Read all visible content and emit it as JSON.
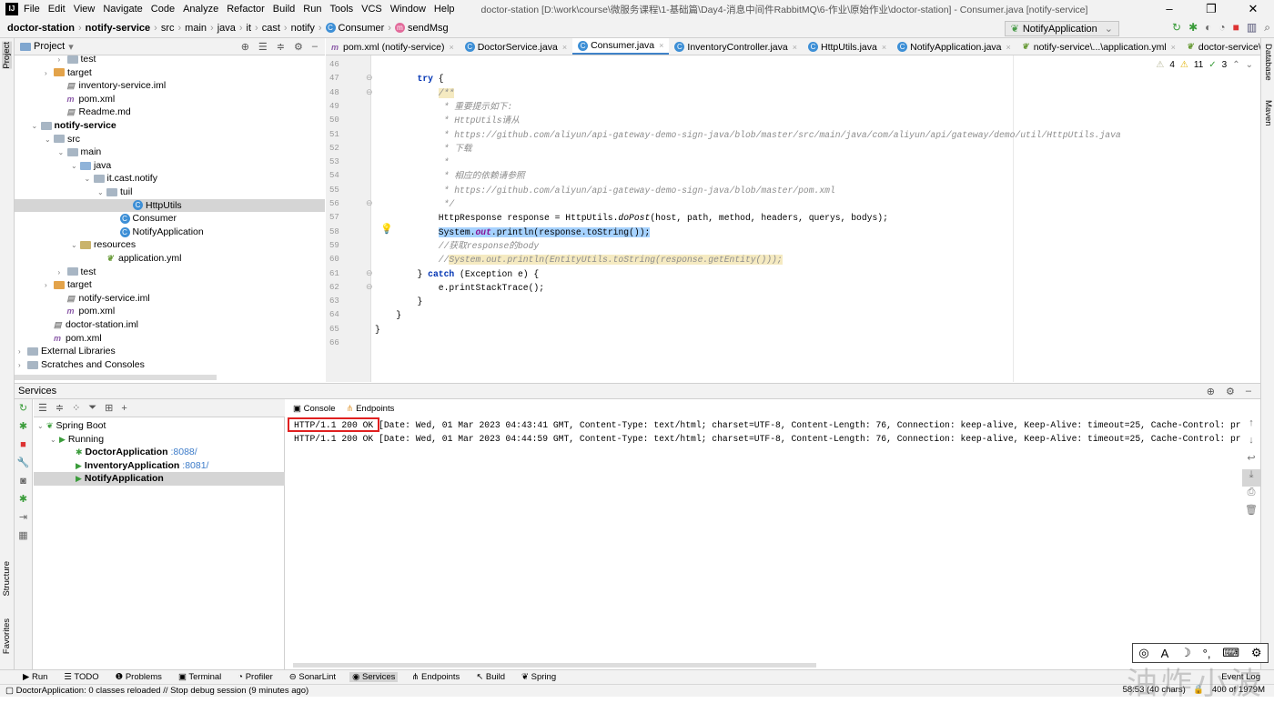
{
  "menu": {
    "items": [
      "File",
      "Edit",
      "View",
      "Navigate",
      "Code",
      "Analyze",
      "Refactor",
      "Build",
      "Run",
      "Tools",
      "VCS",
      "Window",
      "Help"
    ],
    "title": "doctor-station [D:\\work\\course\\微服务课程\\1-基础篇\\Day4-消息中间件RabbitMQ\\6-作业\\原始作业\\doctor-station] - Consumer.java [notify-service]"
  },
  "breadcrumb": [
    "doctor-station",
    "notify-service",
    "src",
    "main",
    "java",
    "it",
    "cast",
    "notify",
    "Consumer",
    "sendMsg"
  ],
  "run_config": "NotifyApplication",
  "left_stripe": {
    "project": "Project",
    "structure": "Structure",
    "favorites": "Favorites"
  },
  "right_stripe": {
    "database": "Database",
    "maven": "Maven"
  },
  "project": {
    "title": "Project",
    "tree": [
      {
        "label": "test",
        "depth": 3,
        "type": "folder",
        "arrow": "›"
      },
      {
        "label": "target",
        "depth": 2,
        "type": "tgt",
        "arrow": "›"
      },
      {
        "label": "inventory-service.iml",
        "depth": 3,
        "type": "file"
      },
      {
        "label": "pom.xml",
        "depth": 3,
        "type": "maven"
      },
      {
        "label": "Readme.md",
        "depth": 3,
        "type": "file"
      },
      {
        "label": "notify-service",
        "depth": 1,
        "type": "folder",
        "arrow": "⌄",
        "bold": true
      },
      {
        "label": "src",
        "depth": 2,
        "type": "folder",
        "arrow": "⌄"
      },
      {
        "label": "main",
        "depth": 3,
        "type": "folder",
        "arrow": "⌄"
      },
      {
        "label": "java",
        "depth": 4,
        "type": "src",
        "arrow": "⌄"
      },
      {
        "label": "it.cast.notify",
        "depth": 5,
        "type": "folder",
        "arrow": "⌄"
      },
      {
        "label": "tuil",
        "depth": 6,
        "type": "folder",
        "arrow": "⌄"
      },
      {
        "label": "HttpUtils",
        "depth": 8,
        "type": "class",
        "selected": true
      },
      {
        "label": "Consumer",
        "depth": 7,
        "type": "class"
      },
      {
        "label": "NotifyApplication",
        "depth": 7,
        "type": "class"
      },
      {
        "label": "resources",
        "depth": 4,
        "type": "res",
        "arrow": "⌄"
      },
      {
        "label": "application.yml",
        "depth": 6,
        "type": "yml"
      },
      {
        "label": "test",
        "depth": 3,
        "type": "folder",
        "arrow": "›"
      },
      {
        "label": "target",
        "depth": 2,
        "type": "tgt",
        "arrow": "›"
      },
      {
        "label": "notify-service.iml",
        "depth": 3,
        "type": "file"
      },
      {
        "label": "pom.xml",
        "depth": 3,
        "type": "maven"
      },
      {
        "label": "doctor-station.iml",
        "depth": 2,
        "type": "file"
      },
      {
        "label": "pom.xml",
        "depth": 2,
        "type": "maven"
      },
      {
        "label": "External Libraries",
        "depth": 0,
        "type": "lib",
        "arrow": "›"
      },
      {
        "label": "Scratches and Consoles",
        "depth": 0,
        "type": "lib",
        "arrow": "›"
      }
    ]
  },
  "editor": {
    "tabs": [
      {
        "label": "pom.xml (notify-service)",
        "icon": "m"
      },
      {
        "label": "DoctorService.java",
        "icon": "c"
      },
      {
        "label": "Consumer.java",
        "icon": "c",
        "active": true
      },
      {
        "label": "InventoryController.java",
        "icon": "c"
      },
      {
        "label": "HttpUtils.java",
        "icon": "c"
      },
      {
        "label": "NotifyApplication.java",
        "icon": "c"
      },
      {
        "label": "notify-service\\...\\application.yml",
        "icon": "y"
      },
      {
        "label": "doctor-service\\...\\applicatio",
        "icon": "y"
      }
    ],
    "inspections": {
      "weak_warnings": "4",
      "warnings": "11",
      "ok": "3"
    },
    "lines": [
      {
        "n": "46",
        "tokens": []
      },
      {
        "n": "47",
        "tokens": [
          {
            "t": "        "
          },
          {
            "t": "try",
            "c": "kw"
          },
          {
            "t": " {"
          }
        ]
      },
      {
        "n": "48",
        "tokens": [
          {
            "t": "            "
          },
          {
            "t": "/**",
            "c": "cm hlyel"
          }
        ]
      },
      {
        "n": "49",
        "tokens": [
          {
            "t": "             * 重要提示如下:",
            "c": "cm"
          }
        ]
      },
      {
        "n": "50",
        "tokens": [
          {
            "t": "             * HttpUtils请从",
            "c": "cm"
          }
        ]
      },
      {
        "n": "51",
        "tokens": [
          {
            "t": "             * https://github.com/aliyun/api-gateway-demo-sign-java/blob/master/src/main/java/com/aliyun/api/gateway/demo/util/HttpUtils.java",
            "c": "cm"
          }
        ]
      },
      {
        "n": "52",
        "tokens": [
          {
            "t": "             * 下载",
            "c": "cm"
          }
        ]
      },
      {
        "n": "53",
        "tokens": [
          {
            "t": "             *",
            "c": "cm"
          }
        ]
      },
      {
        "n": "54",
        "tokens": [
          {
            "t": "             * 相应的依赖请参照",
            "c": "cm"
          }
        ]
      },
      {
        "n": "55",
        "tokens": [
          {
            "t": "             * https://github.com/aliyun/api-gateway-demo-sign-java/blob/master/pom.xml",
            "c": "cm"
          }
        ]
      },
      {
        "n": "56",
        "tokens": [
          {
            "t": "             */",
            "c": "cm"
          }
        ]
      },
      {
        "n": "57",
        "tokens": [
          {
            "t": "            HttpResponse response = HttpUtils."
          },
          {
            "t": "doPost",
            "c": "mth"
          },
          {
            "t": "(host, path, method, headers, querys, bodys);"
          }
        ]
      },
      {
        "n": "58",
        "tokens": [
          {
            "t": "            "
          },
          {
            "t": "System.",
            "c": "hlsel"
          },
          {
            "t": "out",
            "c": "fld hlsel"
          },
          {
            "t": ".println(response.toString());",
            "c": "hlsel"
          }
        ]
      },
      {
        "n": "59",
        "tokens": [
          {
            "t": "            //获取response的body",
            "c": "cm"
          }
        ]
      },
      {
        "n": "60",
        "tokens": [
          {
            "t": "            //",
            "c": "cm"
          },
          {
            "t": "System.out.println(EntityUtils.toString(response.getEntity()));",
            "c": "cm hlyel"
          }
        ]
      },
      {
        "n": "61",
        "tokens": [
          {
            "t": "        } "
          },
          {
            "t": "catch",
            "c": "kw"
          },
          {
            "t": " (Exception e) {"
          }
        ]
      },
      {
        "n": "62",
        "tokens": [
          {
            "t": "            e.printStackTrace();"
          }
        ]
      },
      {
        "n": "63",
        "tokens": [
          {
            "t": "        }"
          }
        ]
      },
      {
        "n": "64",
        "tokens": [
          {
            "t": "    }"
          }
        ]
      },
      {
        "n": "65",
        "tokens": [
          {
            "t": "}"
          }
        ]
      },
      {
        "n": "66",
        "tokens": []
      }
    ]
  },
  "services": {
    "title": "Services",
    "tree": [
      {
        "label": "Spring Boot",
        "depth": 0,
        "arrow": "⌄",
        "icon": "spring"
      },
      {
        "label": "Running",
        "depth": 1,
        "arrow": "⌄",
        "icon": "run"
      },
      {
        "label": "DoctorApplication",
        "port": ":8088/",
        "depth": 3,
        "icon": "debug",
        "bold": true
      },
      {
        "label": "InventoryApplication",
        "port": ":8081/",
        "depth": 3,
        "icon": "run",
        "bold": true
      },
      {
        "label": "NotifyApplication",
        "depth": 3,
        "icon": "run",
        "bold": true,
        "selected": true
      }
    ],
    "console_tabs": [
      "Console",
      "Endpoints"
    ],
    "console_lines": [
      "HTTP/1.1 200 OK [Date: Wed, 01 Mar 2023 04:43:41 GMT, Content-Type: text/html; charset=UTF-8, Content-Length: 76, Connection: keep-alive, Keep-Alive: timeout=25, Cache-Control: pr",
      "HTTP/1.1 200 OK [Date: Wed, 01 Mar 2023 04:44:59 GMT, Content-Type: text/html; charset=UTF-8, Content-Length: 76, Connection: keep-alive, Keep-Alive: timeout=25, Cache-Control: pr"
    ]
  },
  "bottom_tools": [
    {
      "label": "Run",
      "icon": "▶"
    },
    {
      "label": "TODO",
      "icon": "☰"
    },
    {
      "label": "Problems",
      "icon": "❶"
    },
    {
      "label": "Terminal",
      "icon": "▣"
    },
    {
      "label": "Profiler",
      "icon": "◔"
    },
    {
      "label": "SonarLint",
      "icon": "⊖"
    },
    {
      "label": "Services",
      "icon": "◉",
      "active": true
    },
    {
      "label": "Endpoints",
      "icon": "⋔"
    },
    {
      "label": "Build",
      "icon": "↖"
    },
    {
      "label": "Spring",
      "icon": "❦"
    },
    {
      "label": "Event Log",
      "icon": ""
    }
  ],
  "status": {
    "message": "DoctorApplication: 0 classes reloaded // Stop debug session (9 minutes ago)",
    "position": "58:53 (40 chars)",
    "memory": "400 of 1979M"
  },
  "watermark": "油炸小波",
  "colors": {
    "accent": "#4083c9",
    "selection": "#a6d2ff",
    "highlight_box": "#e02020"
  }
}
